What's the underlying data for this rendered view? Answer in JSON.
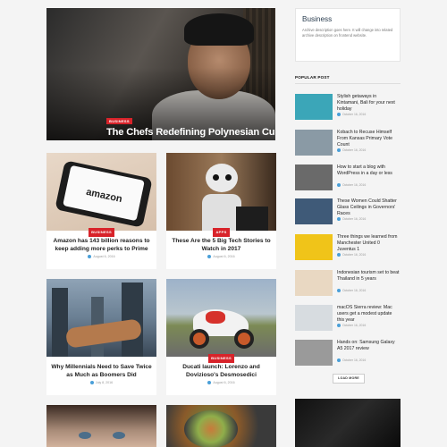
{
  "hero": {
    "category": "Business",
    "title": "The Chefs Redefining Polynesian Cuisine"
  },
  "cards": [
    {
      "category": "Business",
      "title": "Amazon has 143 billion reasons to keep adding more perks to Prime",
      "date": "August 6, 2016"
    },
    {
      "category": "Apps",
      "title": "These Are the 5 Big Tech Stories to Watch in 2017",
      "date": "August 6, 2016"
    },
    {
      "category": "",
      "title": "Why Millennials Need to Save Twice as Much as Boomers Did",
      "date": "July 8, 2016"
    },
    {
      "category": "Business",
      "title": "Ducati launch: Lorenzo and Dovizioso's Desmosedici",
      "date": "August 6, 2016"
    }
  ],
  "sidebar": {
    "archive_title": "Business",
    "archive_description": "Archive description goes here. It will change into related archive description on frontend website.",
    "popular_title": "Popular Post",
    "load_more": "Load More",
    "posts": [
      {
        "title": "Stylish getaways in Kintamani, Bali for your next holiday",
        "date": "October 16, 2016",
        "thumb": "#3ba6b8"
      },
      {
        "title": "Kobach to Recuse Himself From Kansas Primary Vote Count",
        "date": "October 16, 2016",
        "thumb": "#8a9aa5"
      },
      {
        "title": "How to start a blog with WordPress in a day or less",
        "date": "October 16, 2016",
        "thumb": "#6a6a6a"
      },
      {
        "title": "These Women Could Shatter Glass Ceilings in Governors' Races",
        "date": "October 16, 2016",
        "thumb": "#3f5a78"
      },
      {
        "title": "Three things we learned from Manchester United 0 Juventus 1",
        "date": "October 16, 2016",
        "thumb": "#f0c419"
      },
      {
        "title": "Indonesian tourism set to beat Thailand in 5 years",
        "date": "October 16, 2016",
        "thumb": "#e9d8c2"
      },
      {
        "title": "macOS Sierra review: Mac users get a modest update this year",
        "date": "October 16, 2016",
        "thumb": "#d7dce0"
      },
      {
        "title": "Hands on: Samsung Galaxy A5 2017 review",
        "date": "October 16, 2016",
        "thumb": "#9a9a9a"
      }
    ]
  }
}
